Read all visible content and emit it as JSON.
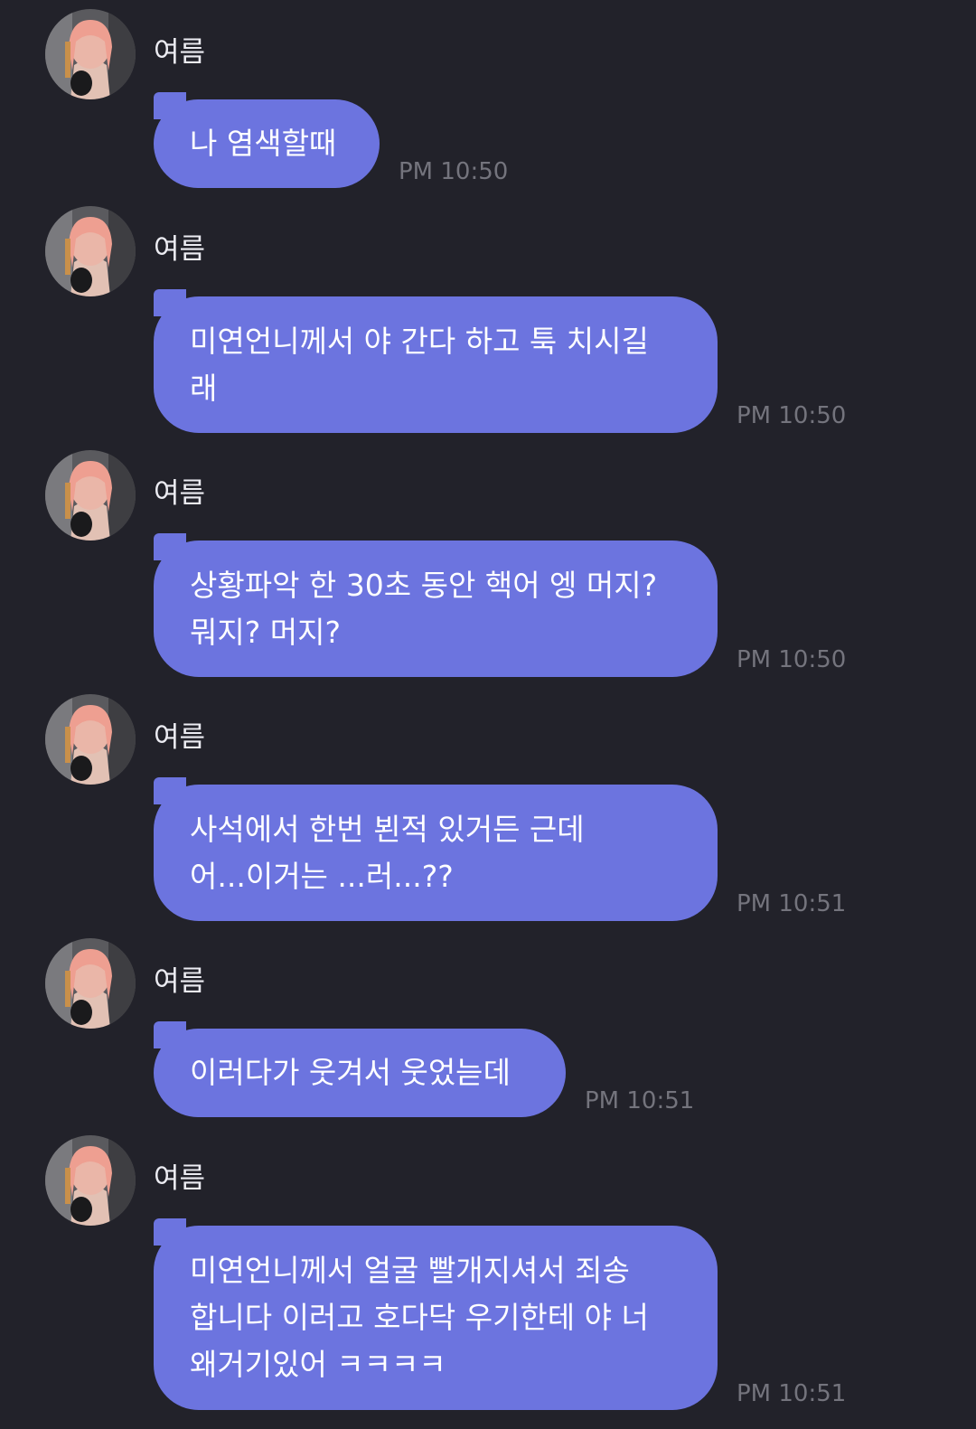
{
  "messages": [
    {
      "sender": "여름",
      "text": "나 염색할때",
      "time": "PM 10:50"
    },
    {
      "sender": "여름",
      "text": "미연언니께서 야 간다 하고 툭 치시길\n래",
      "time": "PM 10:50"
    },
    {
      "sender": "여름",
      "text": "상황파악 한 30초 동안 핵어 엥 머지?\n뭐지? 머지?",
      "time": "PM 10:50"
    },
    {
      "sender": "여름",
      "text": "사석에서 한번 뵌적 있거든 근데\n어...이거는 ...러...??",
      "time": "PM 10:51"
    },
    {
      "sender": "여름",
      "text": "이러다가 웃겨서 웃었늗데",
      "time": "PM 10:51"
    },
    {
      "sender": "여름",
      "text": "미연언니께서 얼굴 빨개지셔서 죄송\n합니다 이러고 호다닥 우기한테 야 너\n왜거기있어 ㅋㅋㅋㅋ",
      "time": "PM 10:51"
    }
  ],
  "colors": {
    "background": "#22222a",
    "bubble": "#6c74df",
    "bubble_text": "#ffffff",
    "sender_text": "#ececf2",
    "timestamp": "#74747d"
  },
  "icons": {
    "avatar": "profile-photo"
  }
}
